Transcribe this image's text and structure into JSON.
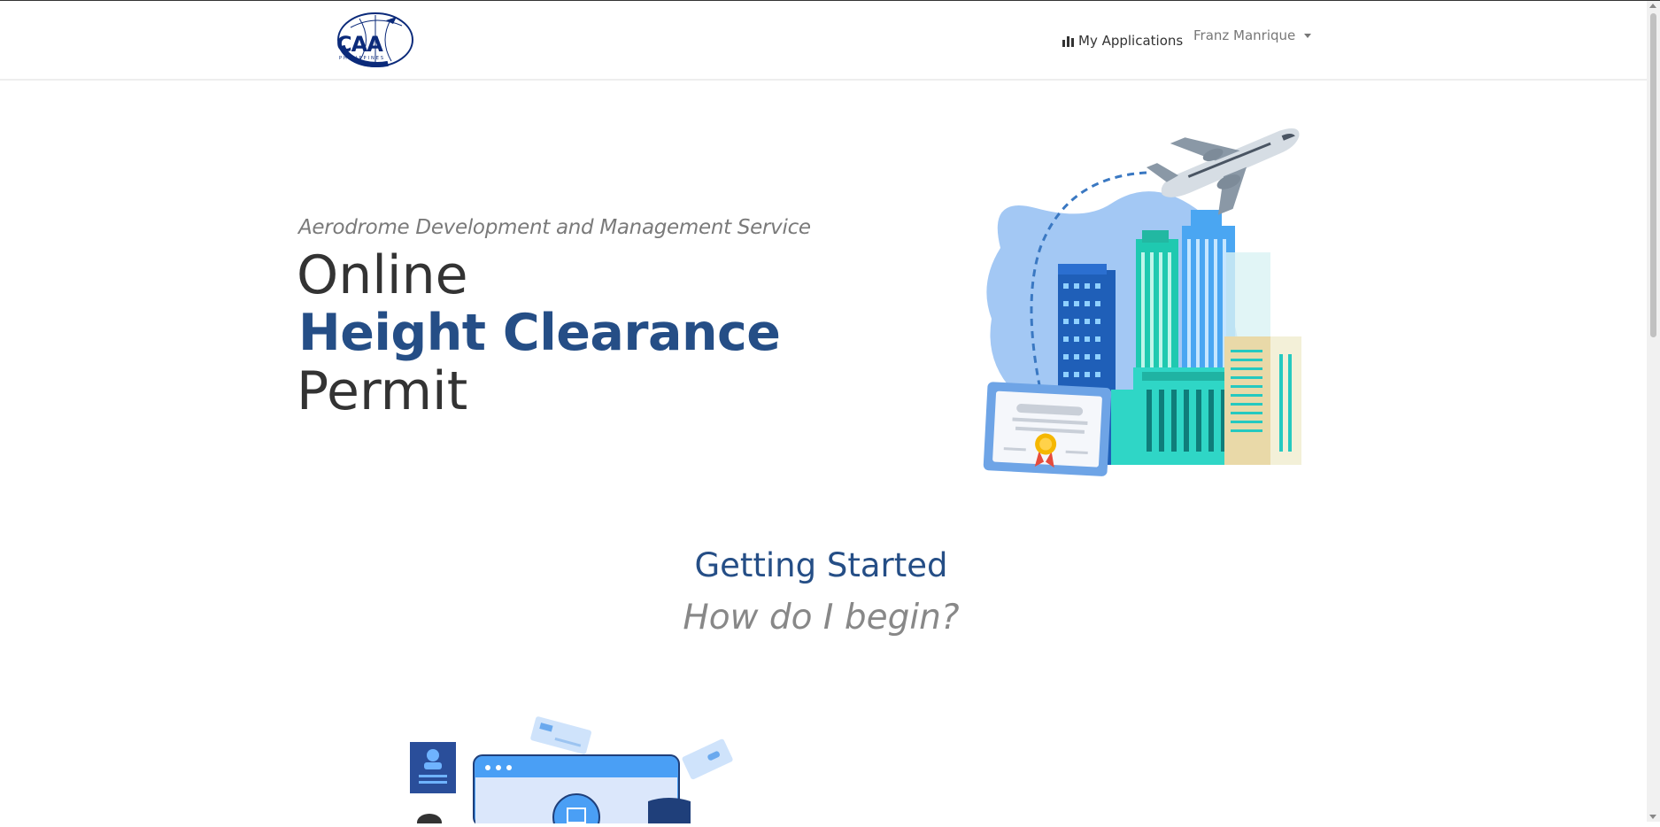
{
  "navbar": {
    "logo_text": "CAA",
    "logo_subtext": "PHILIPPINES",
    "my_applications_label": "My Applications",
    "user_name": "Franz Manrique"
  },
  "hero": {
    "subtitle": "Aerodrome Development and Management Service",
    "line1": "Online",
    "line2": "Height Clearance",
    "line3": "Permit"
  },
  "getting_started": {
    "title": "Getting Started",
    "subtitle": "How do I begin?"
  },
  "icons": {
    "applications": "bar-chart-icon",
    "user_menu": "caret-down-icon"
  },
  "colors": {
    "brand": "#254e86",
    "accent": "#4a9ff5"
  }
}
